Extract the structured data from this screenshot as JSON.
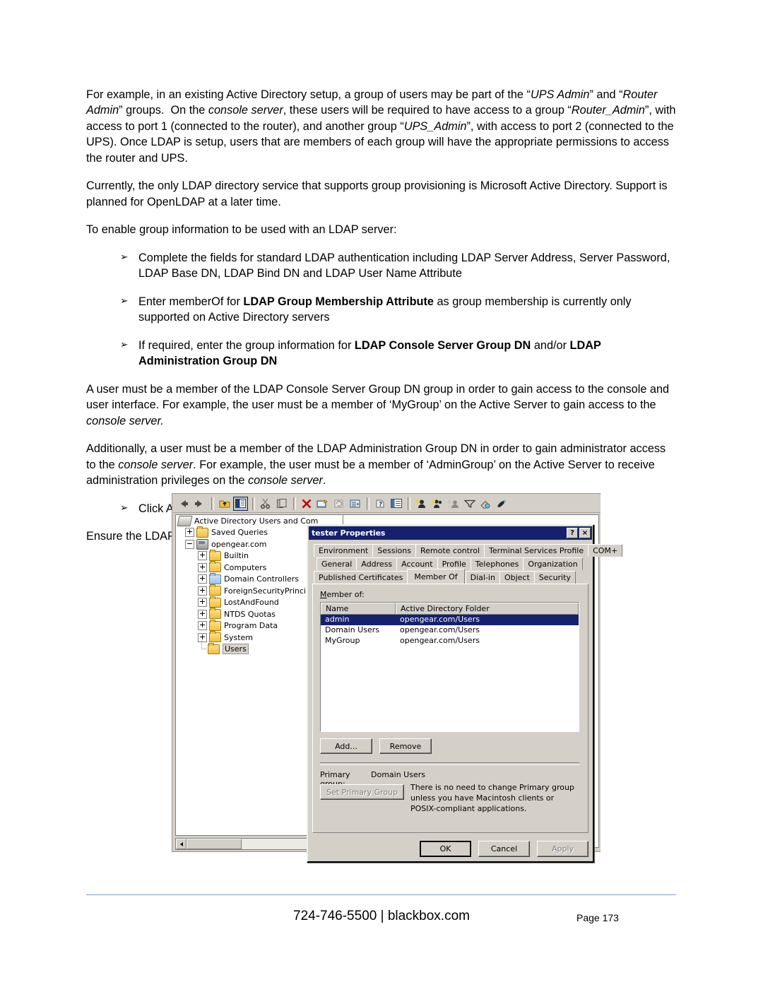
{
  "document": {
    "paragraphs": [
      {
        "id": "p1",
        "runs": [
          {
            "t": "For example, in an existing Active Directory setup, a group of users may be part of the “",
            "s": "n"
          },
          {
            "t": "UPS Admin",
            "s": "i"
          },
          {
            "t": "” and “",
            "s": "n"
          },
          {
            "t": "Router Admin",
            "s": "i"
          },
          {
            "t": "” groups.  On the ",
            "s": "n"
          },
          {
            "t": "console server",
            "s": "i"
          },
          {
            "t": ", these users will be required to have access to a group “",
            "s": "n"
          },
          {
            "t": "Router_Admin",
            "s": "i"
          },
          {
            "t": "”, with access to port 1 (connected to the router), and another group “",
            "s": "n"
          },
          {
            "t": "UPS_Admin",
            "s": "i"
          },
          {
            "t": "”, with access to port 2 (connected to the UPS). Once LDAP is setup, users that are members of each group will have the appropriate permissions to access the router and UPS.",
            "s": "n"
          }
        ]
      },
      {
        "id": "p2",
        "runs": [
          {
            "t": "Currently, the only LDAP directory service that supports group provisioning is Microsoft Active Directory. Support is planned for OpenLDAP at a later time.",
            "s": "n"
          }
        ]
      },
      {
        "id": "p3",
        "runs": [
          {
            "t": "To enable group information to be used with an LDAP server:",
            "s": "n"
          }
        ]
      }
    ],
    "bullets_primary": [
      {
        "marker": "➢",
        "runs": [
          {
            "t": "Complete the fields for standard LDAP authentication including LDAP Server Address, Server Password, LDAP Base DN, LDAP Bind DN and LDAP User Name Attribute",
            "s": "n"
          }
        ]
      },
      {
        "marker": "➢",
        "runs": [
          {
            "t": "Enter memberOf for ",
            "s": "n"
          },
          {
            "t": "LDAP Group Membership Attribute",
            "s": "b"
          },
          {
            "t": " as group membership is currently only supported on Active Directory servers",
            "s": "n"
          }
        ]
      },
      {
        "marker": "➢",
        "runs": [
          {
            "t": "If required, enter the group information for ",
            "s": "n"
          },
          {
            "t": "LDAP Console Server Group DN",
            "s": "b"
          },
          {
            "t": " and/or ",
            "s": "n"
          },
          {
            "t": "LDAP Administration Group DN",
            "s": "b"
          }
        ]
      }
    ],
    "paragraphs_after": [
      {
        "id": "p4",
        "runs": [
          {
            "t": "A user must be a member of the LDAP Console Server Group DN group in order to gain access to the console and user interface. For example, the user must be a member of ‘MyGroup’ on the Active Server to gain access to the ",
            "s": "n"
          },
          {
            "t": "console server.",
            "s": "i"
          }
        ]
      },
      {
        "id": "p5",
        "runs": [
          {
            "t": "Additionally, a user must be a member of the LDAP Administration Group DN in order to gain administrator access to the ",
            "s": "n"
          },
          {
            "t": "console server",
            "s": "i"
          },
          {
            "t": ".  For example, the user must be a member of ‘AdminGroup’ on the Active Server to receive administration privileges on the ",
            "s": "n"
          },
          {
            "t": "console server",
            "s": "i"
          },
          {
            "t": ".",
            "s": "n"
          }
        ]
      }
    ],
    "bullets_secondary": [
      {
        "marker": "➢",
        "runs": [
          {
            "t": "Click Apply.",
            "s": "n"
          }
        ]
      }
    ],
    "paragraphs_final": [
      {
        "id": "p6",
        "runs": [
          {
            "t": "Ensure the LDAP service is operational and group names are correct within the Active Directory",
            "s": "n"
          }
        ]
      }
    ]
  },
  "screenshot": {
    "mmc": {
      "toolbar_icons": [
        "back-arrow-icon",
        "forward-arrow-icon",
        "up-one-level-icon",
        "show-hide-tree-icon",
        "cut-icon",
        "copy-icon",
        "delete-icon",
        "properties-icon",
        "refresh-icon",
        "export-list-icon",
        "help-icon",
        "console-icon",
        "new-user-icon",
        "new-group-icon",
        "new-contact-icon",
        "filter-icon",
        "find-icon",
        "action-icon"
      ],
      "tree": [
        {
          "label": "Active Directory Users and Com",
          "icon": "ad-snapin-icon",
          "level": 0,
          "expander": "none",
          "selected": false
        },
        {
          "label": "Saved Queries",
          "icon": "folder-icon",
          "level": 1,
          "expander": "plus",
          "selected": false
        },
        {
          "label": "opengear.com",
          "icon": "domain-icon",
          "level": 1,
          "expander": "minus",
          "selected": false
        },
        {
          "label": "Builtin",
          "icon": "folder-icon",
          "level": 2,
          "expander": "plus",
          "selected": false
        },
        {
          "label": "Computers",
          "icon": "folder-icon",
          "level": 2,
          "expander": "plus",
          "selected": false
        },
        {
          "label": "Domain Controllers",
          "icon": "folder-dc-icon",
          "level": 2,
          "expander": "plus",
          "selected": false
        },
        {
          "label": "ForeignSecurityPrincipal",
          "icon": "folder-icon",
          "level": 2,
          "expander": "plus",
          "selected": false
        },
        {
          "label": "LostAndFound",
          "icon": "folder-icon",
          "level": 2,
          "expander": "plus",
          "selected": false
        },
        {
          "label": "NTDS Quotas",
          "icon": "folder-icon",
          "level": 2,
          "expander": "plus",
          "selected": false
        },
        {
          "label": "Program Data",
          "icon": "folder-icon",
          "level": 2,
          "expander": "plus",
          "selected": false
        },
        {
          "label": "System",
          "icon": "folder-icon",
          "level": 2,
          "expander": "plus",
          "selected": false
        },
        {
          "label": "Users",
          "icon": "folder-icon",
          "level": 2,
          "expander": "leaf",
          "selected": true
        }
      ]
    },
    "dialog": {
      "title": "tester Properties",
      "help_button": "?",
      "close_button": "×",
      "tab_rows": [
        [
          "Environment",
          "Sessions",
          "Remote control",
          "Terminal Services Profile",
          "COM+"
        ],
        [
          "General",
          "Address",
          "Account",
          "Profile",
          "Telephones",
          "Organization"
        ],
        [
          "Published Certificates",
          "Member Of",
          "Dial-in",
          "Object",
          "Security"
        ]
      ],
      "active_tab": "Member Of",
      "member_of_label": "Member of:",
      "columns": [
        "Name",
        "Active Directory Folder"
      ],
      "rows": [
        {
          "name": "admin",
          "folder": "opengear.com/Users",
          "selected": true
        },
        {
          "name": "Domain Users",
          "folder": "opengear.com/Users",
          "selected": false
        },
        {
          "name": "MyGroup",
          "folder": "opengear.com/Users",
          "selected": false
        }
      ],
      "add_button": "Add...",
      "remove_button": "Remove",
      "primary_group_label": "Primary group:",
      "primary_group_value": "Domain Users",
      "set_primary_group_button": "Set Primary Group",
      "set_primary_group_disabled": true,
      "hint_text": "There is no need to change Primary group unless you have Macintosh clients or POSIX-compliant applications.",
      "ok_button": "OK",
      "cancel_button": "Cancel",
      "apply_button": "Apply",
      "apply_disabled": true,
      "colors": {
        "titlebar": "#16216e",
        "selection": "#16216e",
        "face": "#d4d0c8"
      }
    }
  },
  "footer": {
    "contact": "724-746-5500 | blackbox.com",
    "page": "Page  173"
  }
}
